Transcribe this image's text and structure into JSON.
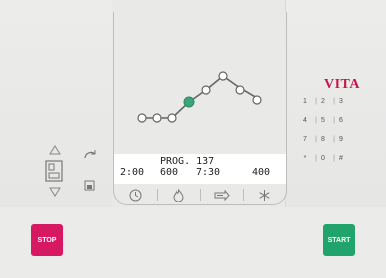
{
  "display": {
    "program_label": "PROG. 137",
    "time1": "2:00",
    "temp1": "600",
    "time2": "7:30",
    "temp2": "400",
    "icons": [
      "clock-icon",
      "flame-icon",
      "vacuum-icon",
      "cooling-icon"
    ]
  },
  "brand": "VITA",
  "keypad": [
    "1",
    "2",
    "3",
    "4",
    "5",
    "6",
    "7",
    "8",
    "9",
    "*",
    "0",
    "#"
  ],
  "buttons": {
    "stop": "STOP",
    "start": "START"
  },
  "colors": {
    "stop": "#d71862",
    "start": "#21a46b",
    "brand": "#c4184b",
    "active_node": "#3aa576"
  }
}
